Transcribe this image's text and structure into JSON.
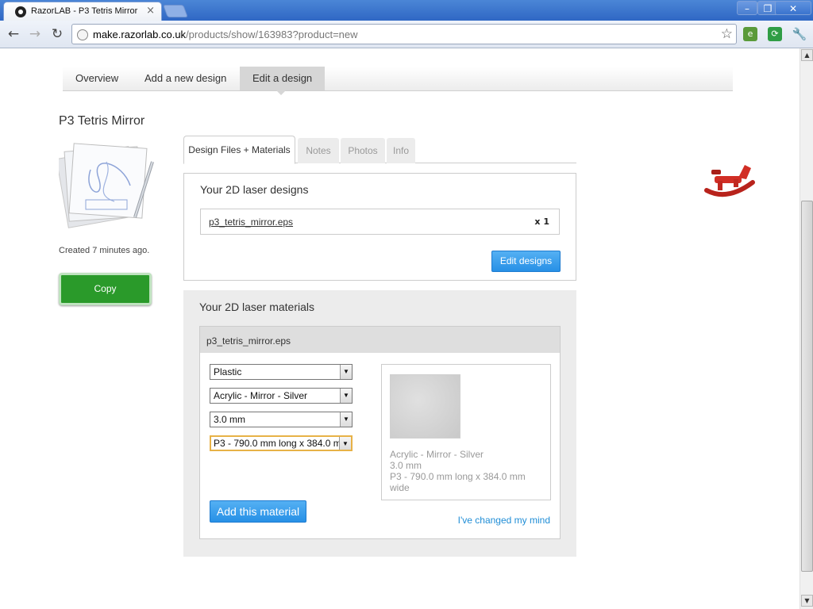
{
  "browser": {
    "tab_title": "RazorLAB - P3 Tetris Mirror",
    "tab_close": "×",
    "url_host": "make.razorlab.co.uk",
    "url_path": "/products/show/163983?product=new",
    "win_min": "–",
    "win_max": "❐",
    "win_close": "✕"
  },
  "page_nav": {
    "items": [
      "Overview",
      "Add a new design",
      "Edit a design"
    ],
    "active": "Edit a design"
  },
  "product": {
    "title": "P3 Tetris Mirror",
    "created": "Created 7 minutes ago.",
    "copy_label": "Copy"
  },
  "inner_tabs": [
    "Design Files + Materials",
    "Notes",
    "Photos",
    "Info"
  ],
  "designs": {
    "heading": "Your 2D laser designs",
    "file_name": "p3_tetris_mirror.eps",
    "file_count": "x 1",
    "edit_label": "Edit designs"
  },
  "materials": {
    "heading": "Your 2D laser materials",
    "card_title": "p3_tetris_mirror.eps",
    "selects": [
      "Plastic",
      "Acrylic - Mirror - Silver",
      "3.0 mm",
      "P3 - 790.0 mm long x 384.0 mm wide"
    ],
    "preview_lines": [
      "Acrylic - Mirror - Silver",
      "3.0 mm",
      "P3 - 790.0 mm long x 384.0 mm",
      "wide"
    ],
    "add_label": "Add this material",
    "changed_label": "I've changed my mind"
  },
  "colors": {
    "accent_blue": "#2790e6",
    "copy_green": "#2a9a2a",
    "titlebar_blue": "#2f67c4"
  }
}
